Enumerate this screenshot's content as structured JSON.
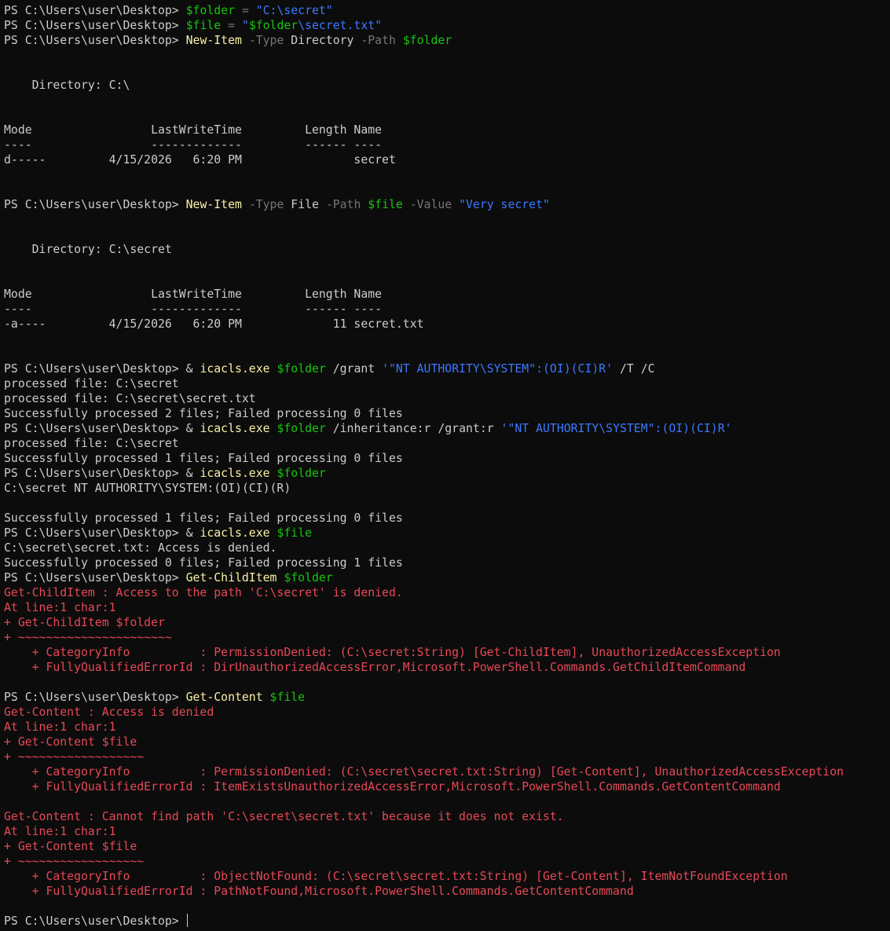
{
  "colors": {
    "background": "#0c0c0c",
    "default_text": "#cccccc",
    "cmdlet": "#f9f1a5",
    "variable": "#16c60c",
    "string": "#3b78ff",
    "parameter": "#767676",
    "error": "#e74856"
  },
  "lines": [
    [
      {
        "t": "PS C:\\Users\\user\\Desktop> ",
        "c": "w"
      },
      {
        "t": "$folder",
        "c": "g"
      },
      {
        "t": " = ",
        "c": "d"
      },
      {
        "t": "\"C:\\secret\"",
        "c": "b"
      }
    ],
    [
      {
        "t": "PS C:\\Users\\user\\Desktop> ",
        "c": "w"
      },
      {
        "t": "$file",
        "c": "g"
      },
      {
        "t": " = ",
        "c": "d"
      },
      {
        "t": "\"",
        "c": "b"
      },
      {
        "t": "$folder",
        "c": "g"
      },
      {
        "t": "\\secret.txt\"",
        "c": "b"
      }
    ],
    [
      {
        "t": "PS C:\\Users\\user\\Desktop> ",
        "c": "w"
      },
      {
        "t": "New-Item",
        "c": "y"
      },
      {
        "t": " -Type ",
        "c": "d"
      },
      {
        "t": "Directory",
        "c": "w"
      },
      {
        "t": " -Path ",
        "c": "d"
      },
      {
        "t": "$folder",
        "c": "g"
      }
    ],
    [],
    [],
    [
      {
        "t": "    Directory: C:\\",
        "c": "w"
      }
    ],
    [],
    [],
    [
      {
        "t": "Mode                 LastWriteTime         Length Name",
        "c": "w"
      }
    ],
    [
      {
        "t": "----                 -------------         ------ ----",
        "c": "w"
      }
    ],
    [
      {
        "t": "d-----         4/15/2026   6:20 PM                secret",
        "c": "w"
      }
    ],
    [],
    [],
    [
      {
        "t": "PS C:\\Users\\user\\Desktop> ",
        "c": "w"
      },
      {
        "t": "New-Item",
        "c": "y"
      },
      {
        "t": " -Type ",
        "c": "d"
      },
      {
        "t": "File",
        "c": "w"
      },
      {
        "t": " -Path ",
        "c": "d"
      },
      {
        "t": "$file",
        "c": "g"
      },
      {
        "t": " -Value ",
        "c": "d"
      },
      {
        "t": "\"Very secret\"",
        "c": "b"
      }
    ],
    [],
    [],
    [
      {
        "t": "    Directory: C:\\secret",
        "c": "w"
      }
    ],
    [],
    [],
    [
      {
        "t": "Mode                 LastWriteTime         Length Name",
        "c": "w"
      }
    ],
    [
      {
        "t": "----                 -------------         ------ ----",
        "c": "w"
      }
    ],
    [
      {
        "t": "-a----         4/15/2026   6:20 PM             11 secret.txt",
        "c": "w"
      }
    ],
    [],
    [],
    [
      {
        "t": "PS C:\\Users\\user\\Desktop> ",
        "c": "w"
      },
      {
        "t": "& ",
        "c": "w"
      },
      {
        "t": "icacls.exe",
        "c": "y"
      },
      {
        "t": " ",
        "c": "w"
      },
      {
        "t": "$folder",
        "c": "g"
      },
      {
        "t": " /grant ",
        "c": "w"
      },
      {
        "t": "'\"NT AUTHORITY\\SYSTEM\":(OI)(CI)R'",
        "c": "b"
      },
      {
        "t": " /T /C",
        "c": "w"
      }
    ],
    [
      {
        "t": "processed file: C:\\secret",
        "c": "w"
      }
    ],
    [
      {
        "t": "processed file: C:\\secret\\secret.txt",
        "c": "w"
      }
    ],
    [
      {
        "t": "Successfully processed 2 files; Failed processing 0 files",
        "c": "w"
      }
    ],
    [
      {
        "t": "PS C:\\Users\\user\\Desktop> ",
        "c": "w"
      },
      {
        "t": "& ",
        "c": "w"
      },
      {
        "t": "icacls.exe",
        "c": "y"
      },
      {
        "t": " ",
        "c": "w"
      },
      {
        "t": "$folder",
        "c": "g"
      },
      {
        "t": " /inheritance:r /grant:r ",
        "c": "w"
      },
      {
        "t": "'\"NT AUTHORITY\\SYSTEM\":(OI)(CI)R'",
        "c": "b"
      }
    ],
    [
      {
        "t": "processed file: C:\\secret",
        "c": "w"
      }
    ],
    [
      {
        "t": "Successfully processed 1 files; Failed processing 0 files",
        "c": "w"
      }
    ],
    [
      {
        "t": "PS C:\\Users\\user\\Desktop> ",
        "c": "w"
      },
      {
        "t": "& ",
        "c": "w"
      },
      {
        "t": "icacls.exe",
        "c": "y"
      },
      {
        "t": " ",
        "c": "w"
      },
      {
        "t": "$folder",
        "c": "g"
      }
    ],
    [
      {
        "t": "C:\\secret NT AUTHORITY\\SYSTEM:(OI)(CI)(R)",
        "c": "w"
      }
    ],
    [],
    [
      {
        "t": "Successfully processed 1 files; Failed processing 0 files",
        "c": "w"
      }
    ],
    [
      {
        "t": "PS C:\\Users\\user\\Desktop> ",
        "c": "w"
      },
      {
        "t": "& ",
        "c": "w"
      },
      {
        "t": "icacls.exe",
        "c": "y"
      },
      {
        "t": " ",
        "c": "w"
      },
      {
        "t": "$file",
        "c": "g"
      }
    ],
    [
      {
        "t": "C:\\secret\\secret.txt: Access is denied.",
        "c": "w"
      }
    ],
    [
      {
        "t": "Successfully processed 0 files; Failed processing 1 files",
        "c": "w"
      }
    ],
    [
      {
        "t": "PS C:\\Users\\user\\Desktop> ",
        "c": "w"
      },
      {
        "t": "Get-ChildItem",
        "c": "y"
      },
      {
        "t": " ",
        "c": "w"
      },
      {
        "t": "$folder",
        "c": "g"
      }
    ],
    [
      {
        "t": "Get-ChildItem : Access to the path 'C:\\secret' is denied.",
        "c": "r"
      }
    ],
    [
      {
        "t": "At line:1 char:1",
        "c": "r"
      }
    ],
    [
      {
        "t": "+ Get-ChildItem $folder",
        "c": "r"
      }
    ],
    [
      {
        "t": "+ ~~~~~~~~~~~~~~~~~~~~~~",
        "c": "r"
      }
    ],
    [
      {
        "t": "    + CategoryInfo          : PermissionDenied: (C:\\secret:String) [Get-ChildItem], UnauthorizedAccessException",
        "c": "r"
      }
    ],
    [
      {
        "t": "    + FullyQualifiedErrorId : DirUnauthorizedAccessError,Microsoft.PowerShell.Commands.GetChildItemCommand",
        "c": "r"
      }
    ],
    [],
    [
      {
        "t": "PS C:\\Users\\user\\Desktop> ",
        "c": "w"
      },
      {
        "t": "Get-Content",
        "c": "y"
      },
      {
        "t": " ",
        "c": "w"
      },
      {
        "t": "$file",
        "c": "g"
      }
    ],
    [
      {
        "t": "Get-Content : Access is denied",
        "c": "r"
      }
    ],
    [
      {
        "t": "At line:1 char:1",
        "c": "r"
      }
    ],
    [
      {
        "t": "+ Get-Content $file",
        "c": "r"
      }
    ],
    [
      {
        "t": "+ ~~~~~~~~~~~~~~~~~~",
        "c": "r"
      }
    ],
    [
      {
        "t": "    + CategoryInfo          : PermissionDenied: (C:\\secret\\secret.txt:String) [Get-Content], UnauthorizedAccessException",
        "c": "r"
      }
    ],
    [
      {
        "t": "    + FullyQualifiedErrorId : ItemExistsUnauthorizedAccessError,Microsoft.PowerShell.Commands.GetContentCommand",
        "c": "r"
      }
    ],
    [],
    [
      {
        "t": "Get-Content : Cannot find path 'C:\\secret\\secret.txt' because it does not exist.",
        "c": "r"
      }
    ],
    [
      {
        "t": "At line:1 char:1",
        "c": "r"
      }
    ],
    [
      {
        "t": "+ Get-Content $file",
        "c": "r"
      }
    ],
    [
      {
        "t": "+ ~~~~~~~~~~~~~~~~~~",
        "c": "r"
      }
    ],
    [
      {
        "t": "    + CategoryInfo          : ObjectNotFound: (C:\\secret\\secret.txt:String) [Get-Content], ItemNotFoundException",
        "c": "r"
      }
    ],
    [
      {
        "t": "    + FullyQualifiedErrorId : PathNotFound,Microsoft.PowerShell.Commands.GetContentCommand",
        "c": "r"
      }
    ],
    []
  ],
  "prompt": {
    "text": "PS C:\\Users\\user\\Desktop> "
  }
}
